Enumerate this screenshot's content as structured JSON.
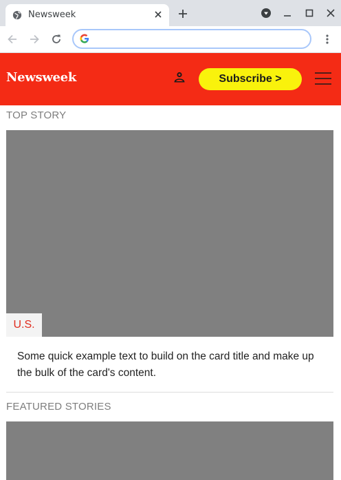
{
  "browser": {
    "tab_title": "Newsweek",
    "url": ""
  },
  "site": {
    "logo": "Newsweek",
    "subscribe_label": "Subscribe >",
    "brand_color": "#f42b15",
    "subscribe_color": "#f9f20c"
  },
  "top_story": {
    "section_label": "TOP STORY",
    "category": "U.S.",
    "text": "Some quick example text to build on the card title and make up the bulk of the card's content."
  },
  "featured": {
    "section_label": "FEATURED STORIES"
  }
}
